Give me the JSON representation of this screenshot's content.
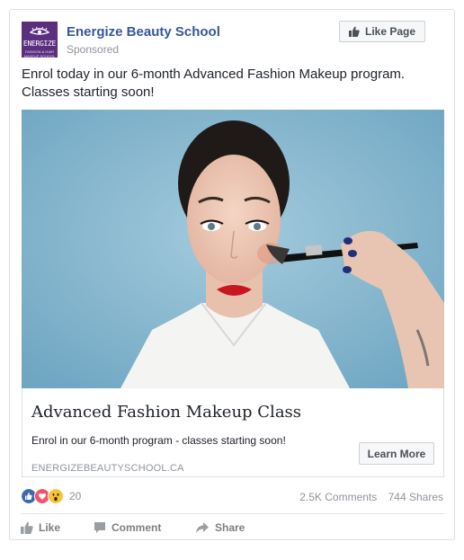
{
  "post": {
    "page_name": "Energize Beauty School",
    "sponsored_label": "Sponsored",
    "like_page_label": "Like Page",
    "text": "Enrol today in our 6-month Advanced Fashion Makeup program. Classes starting soon!",
    "avatar_text": "ENERGIZE",
    "avatar_tagline": "FASHION & HAIR MAKEUP SCHOOL"
  },
  "link": {
    "title": "Advanced Fashion Makeup Class",
    "description": "Enrol in our 6-month program - classes starting soon!",
    "domain": "ENERGIZEBEAUTYSCHOOL.CA",
    "cta_label": "Learn More"
  },
  "engagement": {
    "reaction_count": "20",
    "comments": "2.5K Comments",
    "shares": "744 Shares"
  },
  "actions": {
    "like": "Like",
    "comment": "Comment",
    "share": "Share"
  },
  "colors": {
    "link_blue": "#365899",
    "brand_purple": "#5b2e7e",
    "like_blue": "#4267b2",
    "love_red": "#f25268",
    "wow_yellow": "#f7c438"
  },
  "icons": [
    "thumbs-up-icon",
    "comment-icon",
    "share-icon",
    "like-reaction-icon",
    "love-reaction-icon",
    "wow-reaction-icon"
  ]
}
